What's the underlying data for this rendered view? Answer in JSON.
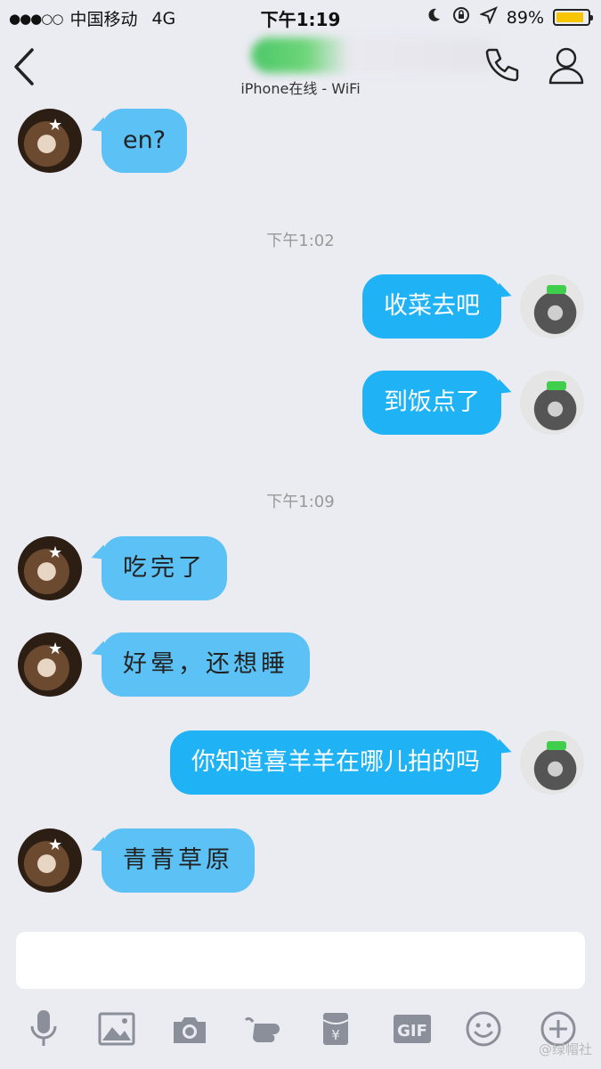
{
  "status_bar": {
    "signal": "●●●○○",
    "carrier": "中国移动",
    "network": "4G",
    "time": "下午1:19",
    "battery": "89%",
    "battery_level": 0.89
  },
  "nav": {
    "subtitle": "iPhone在线 - WiFi"
  },
  "chat": {
    "messages": [
      {
        "sender": "friend",
        "text": "en?"
      },
      {
        "type": "timestamp",
        "text": "下午1:02"
      },
      {
        "sender": "me",
        "text": "收菜去吧"
      },
      {
        "sender": "me",
        "text": "到饭点了"
      },
      {
        "type": "timestamp",
        "text": "下午1:09"
      },
      {
        "sender": "friend",
        "text": "吃完了"
      },
      {
        "sender": "friend",
        "text": "好晕，还想睡"
      },
      {
        "sender": "me",
        "text": "你知道喜羊羊在哪儿拍的吗"
      },
      {
        "sender": "friend",
        "text": "青青草原"
      }
    ]
  },
  "toolbar": {
    "gif_label": "GIF",
    "icons": [
      "microphone-icon",
      "image-icon",
      "camera-icon",
      "poke-icon",
      "red-packet-icon",
      "gif-icon",
      "emoji-icon",
      "plus-icon"
    ]
  },
  "watermark": "@绿帽社",
  "colors": {
    "background": "#ebebf2",
    "my_bubble": "#1fb2f5",
    "friend_bubble": "#5cc2f5",
    "battery": "#f7c600"
  }
}
